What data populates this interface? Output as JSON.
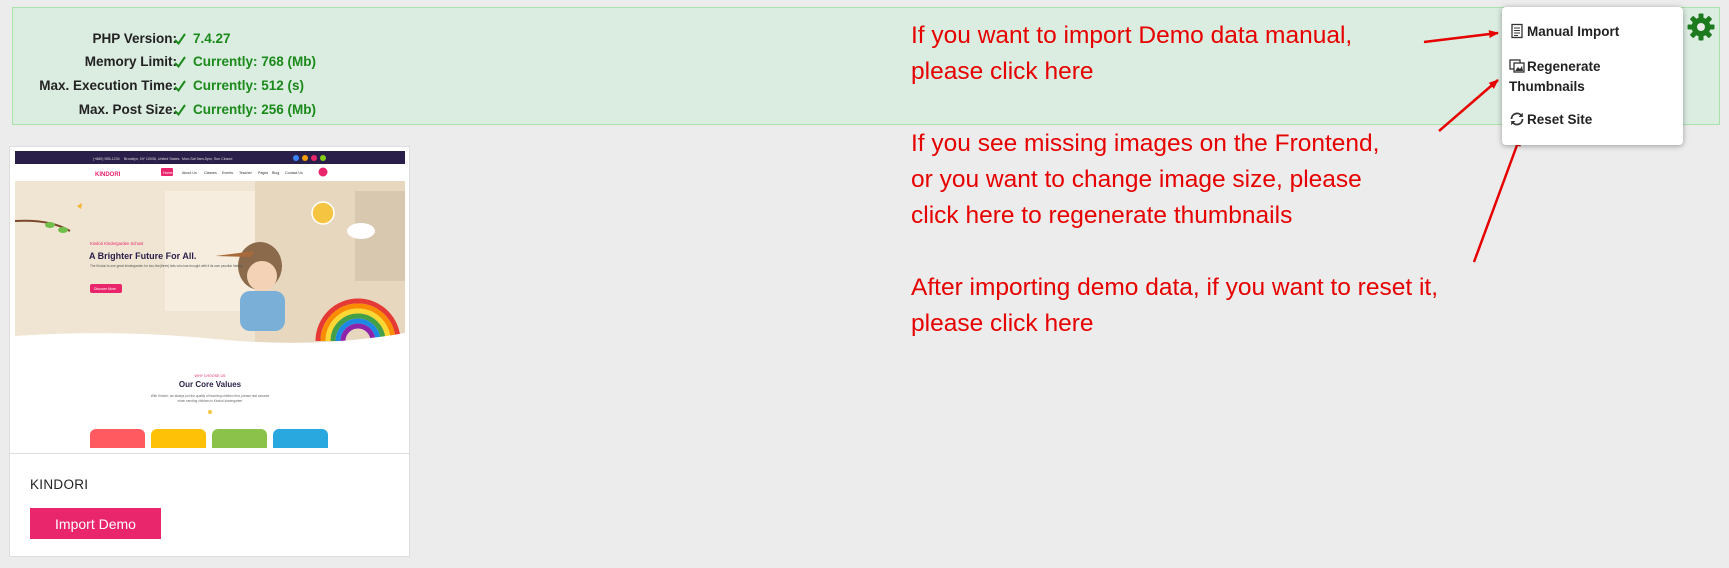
{
  "status": {
    "rows": [
      {
        "label": "PHP Version:",
        "value": "7.4.27"
      },
      {
        "label": "Memory Limit:",
        "value": "Currently: 768 (Mb)"
      },
      {
        "label": "Max. Execution Time:",
        "value": "Currently: 512 (s)"
      },
      {
        "label": "Max. Post Size:",
        "value": "Currently: 256 (Mb)"
      }
    ]
  },
  "annotations": {
    "manual": [
      "If you want to import Demo data manual,",
      "please click here"
    ],
    "regenerate": [
      "If you see missing images on the Frontend,",
      "or you want to change image size, please",
      "click here to regenerate thumbnails"
    ],
    "reset": [
      "After importing demo data, if you want to reset it,",
      "please click here"
    ]
  },
  "menu": {
    "manual_import": "Manual Import",
    "regenerate_line1": "Regenerate",
    "regenerate_line2": "Thumbnails",
    "reset_site": "Reset Site"
  },
  "demo": {
    "name": "KINDORI",
    "import_label": "Import Demo",
    "preview": {
      "topbar_items": [
        "(+880) 555-1234",
        "Brooklyn, NY 10036, United States",
        "Mon-Sat 9am-5pm, Sun Closed"
      ],
      "logo": "KINDORI",
      "nav": [
        "Home",
        "About Us",
        "Classes",
        "Events",
        "Teacher",
        "Pages",
        "Blog",
        "Contact Us"
      ],
      "hero_kicker": "Kindori Kindergarden School",
      "hero_title": "A Brighter Future For All.",
      "hero_text": "The Kindori is one great kindergarden for two-five(three) kids who has brought with it its own peculiar history.",
      "hero_button": "Discover More",
      "section_kicker": "WHY CHOOSE US",
      "section_title": "Our Core Values",
      "section_text_1": "With Kindori, we always put the quality of teaching children first, please rest assured",
      "section_text_2": "when sending children to Kindori kindergarten"
    }
  },
  "colors": {
    "accent": "#e9256c",
    "annotation": "#e60000",
    "ok": "#1a8a1a",
    "gear": "#1e7a1e"
  }
}
